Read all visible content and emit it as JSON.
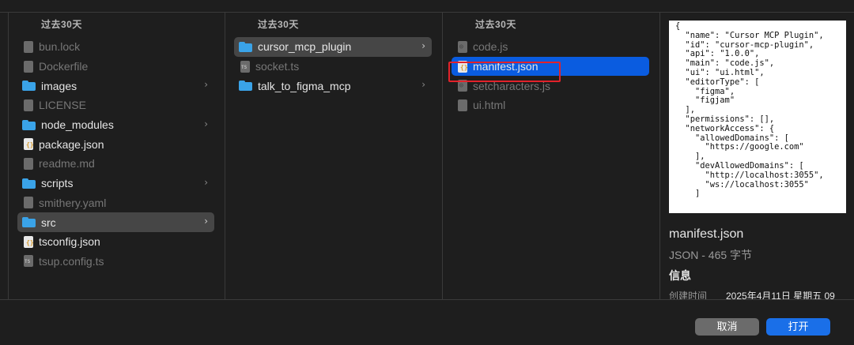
{
  "columns": [
    {
      "header": "过去30天",
      "items": [
        {
          "label": "bun.lock",
          "kind": "doc",
          "dim": true
        },
        {
          "label": "Dockerfile",
          "kind": "doc",
          "dim": true
        },
        {
          "label": "images",
          "kind": "folder",
          "dim": false,
          "chevron": "›"
        },
        {
          "label": "LICENSE",
          "kind": "doc",
          "dim": true
        },
        {
          "label": "node_modules",
          "kind": "folder",
          "dim": false,
          "chevron": "›"
        },
        {
          "label": "package.json",
          "kind": "json",
          "dim": false
        },
        {
          "label": "readme.md",
          "kind": "doc",
          "dim": true
        },
        {
          "label": "scripts",
          "kind": "folder",
          "dim": false,
          "chevron": "›"
        },
        {
          "label": "smithery.yaml",
          "kind": "doc",
          "dim": true
        },
        {
          "label": "src",
          "kind": "folder",
          "dim": false,
          "chevron": "›",
          "selected": "gray"
        },
        {
          "label": "tsconfig.json",
          "kind": "json",
          "dim": false
        },
        {
          "label": "tsup.config.ts",
          "kind": "ts",
          "dim": true
        }
      ]
    },
    {
      "header": "过去30天",
      "items": [
        {
          "label": "cursor_mcp_plugin",
          "kind": "folder",
          "dim": false,
          "chevron": "›",
          "selected": "gray"
        },
        {
          "label": "socket.ts",
          "kind": "ts",
          "dim": true
        },
        {
          "label": "talk_to_figma_mcp",
          "kind": "folder",
          "dim": false,
          "chevron": "›"
        }
      ]
    },
    {
      "header": "过去30天",
      "items": [
        {
          "label": "code.js",
          "kind": "js",
          "dim": true
        },
        {
          "label": "manifest.json",
          "kind": "json",
          "dim": false,
          "selected": "blue"
        },
        {
          "label": "setcharacters.js",
          "kind": "js",
          "dim": true
        },
        {
          "label": "ui.html",
          "kind": "doc",
          "dim": true
        }
      ]
    }
  ],
  "preview": {
    "code": "{\n  \"name\": \"Cursor MCP Plugin\",\n  \"id\": \"cursor-mcp-plugin\",\n  \"api\": \"1.0.0\",\n  \"main\": \"code.js\",\n  \"ui\": \"ui.html\",\n  \"editorType\": [\n    \"figma\",\n    \"figjam\"\n  ],\n  \"permissions\": [],\n  \"networkAccess\": {\n    \"allowedDomains\": [\n      \"https://google.com\"\n    ],\n    \"devAllowedDomains\": [\n      \"http://localhost:3055\",\n      \"ws://localhost:3055\"\n    ]",
    "file_name": "manifest.json",
    "file_kind": "JSON - 465 字节",
    "info_heading": "信息",
    "created_label": "创建时间",
    "created_value": "2025年4月11日 星期五 09"
  },
  "buttons": {
    "cancel": "取消",
    "open": "打开"
  },
  "colors": {
    "selection_blue": "#0a5ce0",
    "folder_blue": "#3aa3e8",
    "highlight_red": "#e2222a",
    "open_button": "#1a6fe8"
  }
}
